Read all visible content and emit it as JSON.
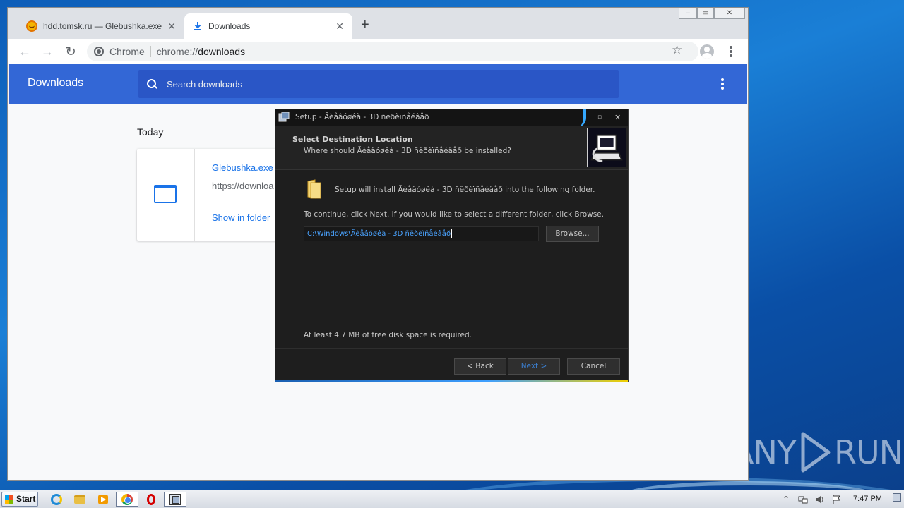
{
  "browser": {
    "tabs": [
      {
        "title": "hdd.tomsk.ru — Glebushka.exe",
        "active": false
      },
      {
        "title": "Downloads",
        "active": true
      }
    ],
    "omnibox": {
      "chip": "Chrome",
      "scheme": "chrome://",
      "path": "downloads"
    }
  },
  "downloads_page": {
    "title": "Downloads",
    "search_placeholder": "Search downloads",
    "section_label": "Today",
    "item": {
      "file_name": "Glebushka.exe",
      "url": "https://downloa",
      "show_in_folder": "Show in folder"
    }
  },
  "setup_dialog": {
    "title": "Setup - Ãèåâóøêà - 3D ñëðèïñåéâåð",
    "heading": "Select Destination Location",
    "subheading": "Where should Ãèåâóøêà - 3D ñëðèïñåéâåð be installed?",
    "install_line": "Setup will install Ãèåâóøêà - 3D ñëðèïñåéâåð into the following folder.",
    "continue_line": "To continue, click Next. If you would like to select a different folder, click Browse.",
    "path_value": "C:\\Windows\\Ãèåâóøêà - 3D ñëðèïñåéâåð",
    "browse_label": "Browse...",
    "space_required": "At least 4.7 MB of free disk space is required.",
    "back_label": "< Back",
    "next_label": "Next >",
    "cancel_label": "Cancel",
    "min_glyph": "▫",
    "close_glyph": "✕"
  },
  "taskbar": {
    "start_label": "Start",
    "clock": "7:47 PM",
    "tray_arrow": "⌃"
  },
  "watermark": {
    "text_left": "ANY",
    "text_right": "RUN"
  },
  "colors": {
    "chrome_blue": "#3367d6",
    "link_blue": "#1a73e8",
    "setup_bg": "#1e1e1e",
    "path_text": "#4aa3ff"
  }
}
